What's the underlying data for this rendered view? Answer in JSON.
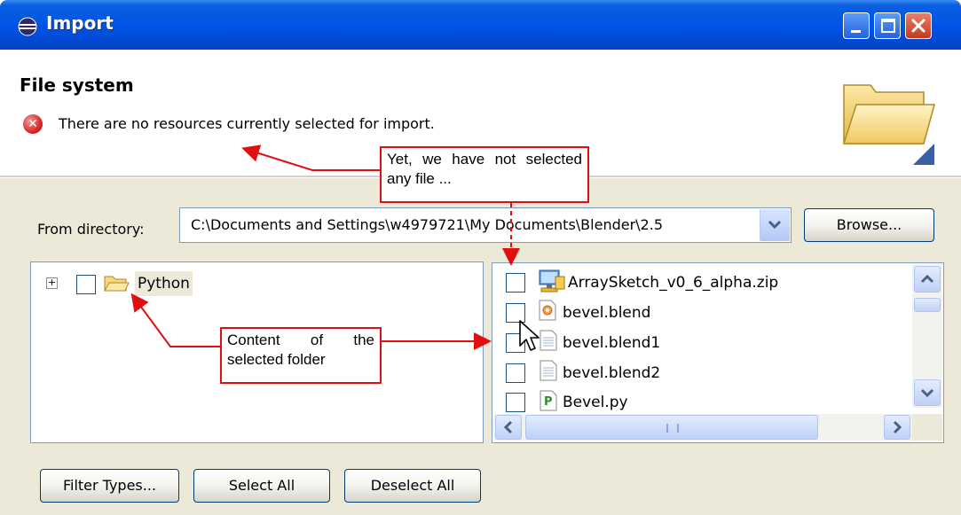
{
  "window": {
    "title": "Import",
    "buttons": [
      "minimize",
      "maximize",
      "close"
    ]
  },
  "header": {
    "title": "File system",
    "error_message": "There are no resources currently selected for import."
  },
  "from_directory": {
    "label": "From directory:",
    "value": "C:\\Documents and Settings\\w4979721\\My Documents\\Blender\\2.5",
    "browse_label": "Browse..."
  },
  "tree": {
    "items": [
      {
        "label": "Python",
        "expanded": false,
        "checked": false
      }
    ]
  },
  "files": {
    "items": [
      {
        "name": "ArraySketch_v0_6_alpha.zip",
        "icon": "zip-icon",
        "checked": false
      },
      {
        "name": "bevel.blend",
        "icon": "blend-icon",
        "checked": false
      },
      {
        "name": "bevel.blend1",
        "icon": "document-icon",
        "checked": false
      },
      {
        "name": "bevel.blend2",
        "icon": "document-icon",
        "checked": false
      },
      {
        "name": "Bevel.py",
        "icon": "python-file-icon",
        "checked": false
      }
    ]
  },
  "buttons": {
    "filter_types": "Filter Types...",
    "select_all": "Select All",
    "deselect_all": "Deselect All"
  },
  "annotations": {
    "not_selected": "Yet, we have not selected any file ...",
    "content": "Content of the selected folder",
    "color": "#e01010"
  },
  "colors": {
    "titlebar": "#0055e5",
    "dialog_bg": "#ece9d8",
    "border": "#7f9db9"
  }
}
